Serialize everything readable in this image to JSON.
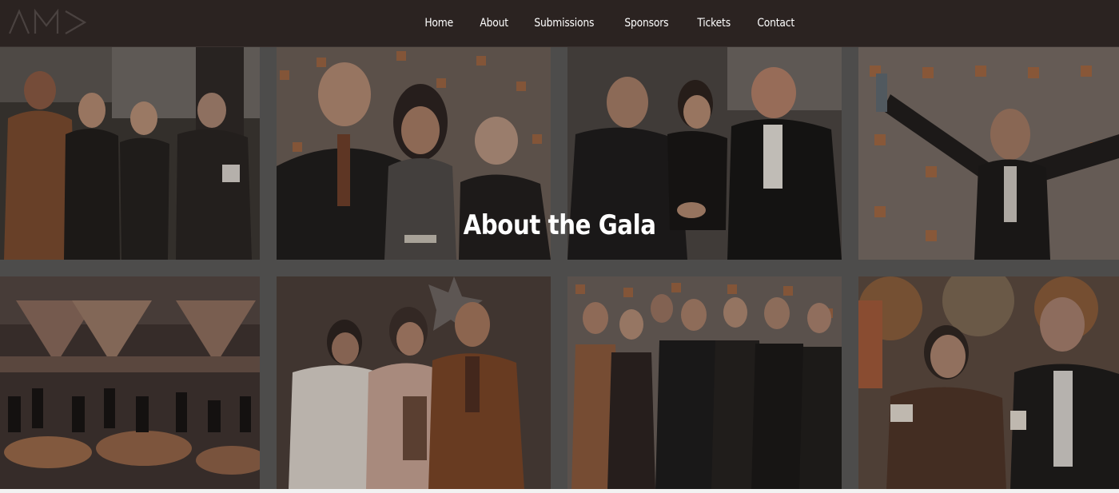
{
  "site": {
    "logo_text": "AM>",
    "logo_icon": "am-arrow-logo",
    "brand_colors": {
      "nav_bg": "#2b2321",
      "accent": "#c0623a",
      "text": "#ffffff"
    }
  },
  "nav": {
    "items": [
      {
        "label": "Home"
      },
      {
        "label": "About"
      },
      {
        "label": "Submissions"
      },
      {
        "label": "Sponsors"
      },
      {
        "label": "Tickets"
      },
      {
        "label": "Contact"
      }
    ]
  },
  "hero": {
    "title": "About the Gala"
  },
  "gallery": {
    "photos": [
      {
        "name": "gala-photo-group-of-four"
      },
      {
        "name": "gala-photo-award-trio"
      },
      {
        "name": "gala-photo-handshake"
      },
      {
        "name": "gala-photo-celebration"
      },
      {
        "name": "gala-photo-banquet-hall"
      },
      {
        "name": "gala-photo-award-winners"
      },
      {
        "name": "gala-photo-group-backdrop"
      },
      {
        "name": "gala-photo-outdoor-pair"
      }
    ]
  }
}
